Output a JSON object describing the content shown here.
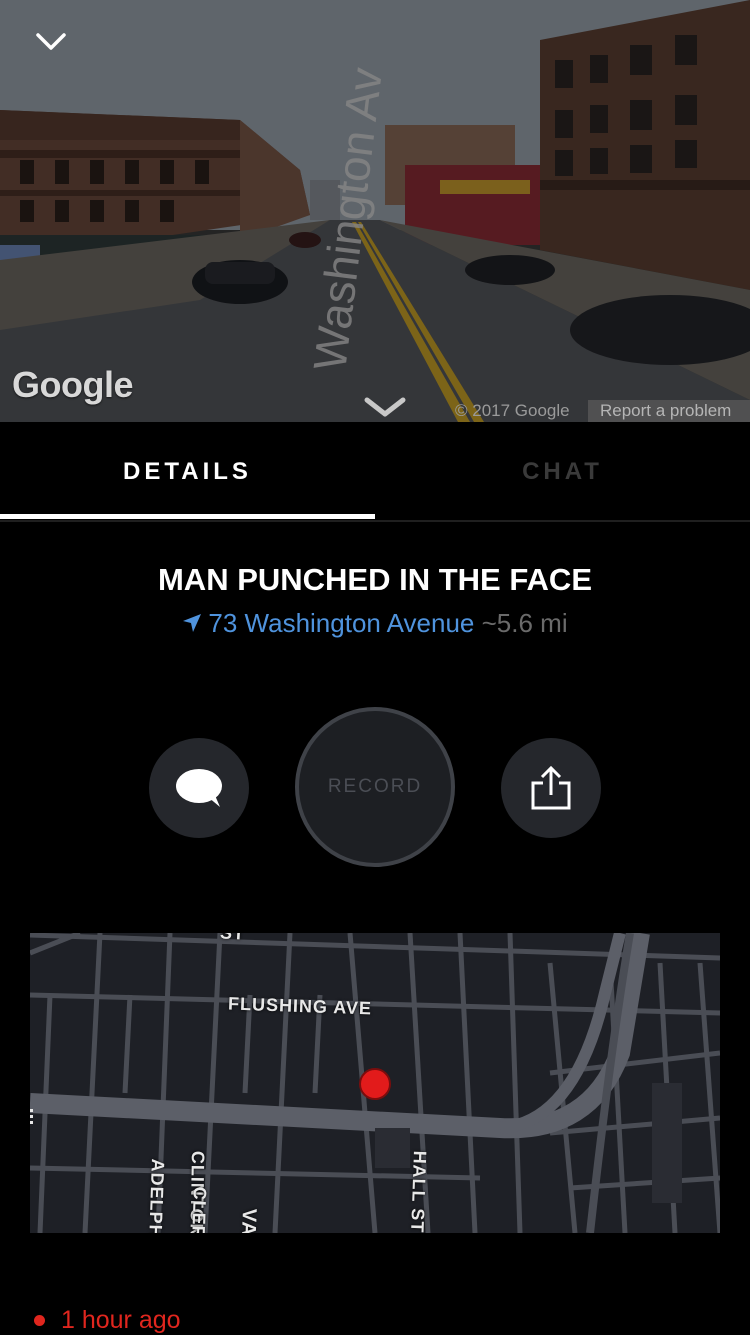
{
  "street_view": {
    "street_label": "Washington Av",
    "logo": "Google",
    "copyright": "© 2017 Google",
    "report_label": "Report a problem",
    "collapse_icon": "chevron-down-icon",
    "nav_icon": "chevron-down-icon"
  },
  "tabs": [
    {
      "label": "DETAILS",
      "active": true
    },
    {
      "label": "CHAT",
      "active": false
    }
  ],
  "incident": {
    "title": "MAN PUNCHED IN THE FACE",
    "address": "73 Washington Avenue",
    "distance": "~5.6 mi",
    "location_icon": "navigation-arrow-icon"
  },
  "actions": {
    "chat_icon": "chat-bubble-icon",
    "record_label": "RECORD",
    "share_icon": "share-icon"
  },
  "map": {
    "streets": {
      "top": "ST",
      "flushing": "FLUSHING AVE",
      "clinton": "CLINTON AVE",
      "hall": "HALL ST",
      "adelphi": "ADELPH",
      "clermont": "CLER",
      "vanderbilt": "VA"
    }
  },
  "timestamp": "1 hour ago",
  "colors": {
    "accent_blue": "#4f93dd",
    "alert_red": "#e0261e",
    "button_bg": "#25272c"
  }
}
